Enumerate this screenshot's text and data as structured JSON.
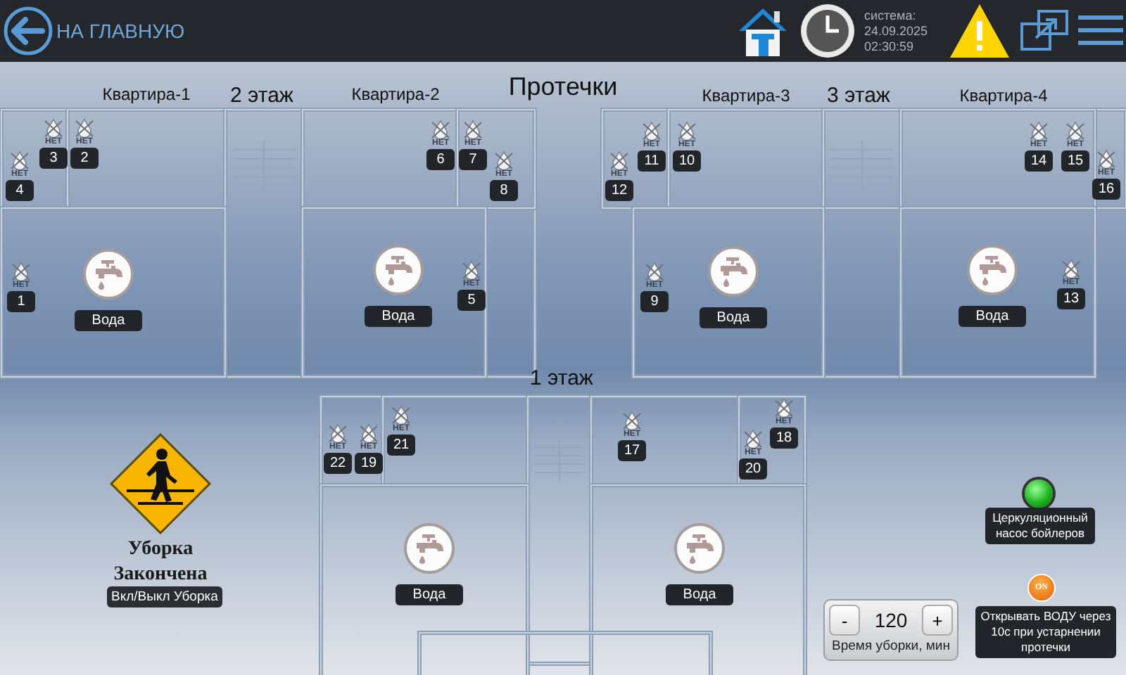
{
  "header": {
    "back_label": "НА ГЛАВНУЮ",
    "system_label": "система:",
    "date": "24.09.2025",
    "time": "02:30:59"
  },
  "title": "Протечки",
  "floors": [
    {
      "label": "2 этаж"
    },
    {
      "label": "3 этаж"
    },
    {
      "label": "1 этаж"
    }
  ],
  "apartments": [
    {
      "label": "Квартира-1"
    },
    {
      "label": "Квартира-2"
    },
    {
      "label": "Квартира-3"
    },
    {
      "label": "Квартира-4"
    }
  ],
  "sensors": [
    {
      "number": "3",
      "status": "НЕТ",
      "leak": false
    },
    {
      "number": "2",
      "status": "НЕТ",
      "leak": false
    },
    {
      "number": "6",
      "status": "НЕТ",
      "leak": false
    },
    {
      "number": "7",
      "status": "НЕТ",
      "leak": false
    },
    {
      "number": "11",
      "status": "НЕТ",
      "leak": false
    },
    {
      "number": "10",
      "status": "НЕТ",
      "leak": false
    },
    {
      "number": "14",
      "status": "НЕТ",
      "leak": false
    },
    {
      "number": "15",
      "status": "НЕТ",
      "leak": false
    },
    {
      "number": "4",
      "status": "НЕТ",
      "leak": false
    },
    {
      "number": "8",
      "status": "НЕТ",
      "leak": false
    },
    {
      "number": "12",
      "status": "НЕТ",
      "leak": false
    },
    {
      "number": "16",
      "status": "НЕТ",
      "leak": false
    },
    {
      "number": "1",
      "status": "НЕТ",
      "leak": false
    },
    {
      "number": "5",
      "status": "НЕТ",
      "leak": false
    },
    {
      "number": "9",
      "status": "НЕТ",
      "leak": false
    },
    {
      "number": "13",
      "status": "НЕТ",
      "leak": false
    },
    {
      "number": "21",
      "status": "НЕТ",
      "leak": false
    },
    {
      "number": "17",
      "status": "НЕТ",
      "leak": false
    },
    {
      "number": "18",
      "status": "НЕТ",
      "leak": false
    },
    {
      "number": "22",
      "status": "НЕТ",
      "leak": false
    },
    {
      "number": "19",
      "status": "НЕТ",
      "leak": false
    },
    {
      "number": "20",
      "status": "НЕТ",
      "leak": false
    }
  ],
  "valves": [
    {
      "label": "Вода"
    },
    {
      "label": "Вода"
    },
    {
      "label": "Вода"
    },
    {
      "label": "Вода"
    },
    {
      "label": "Вода"
    },
    {
      "label": "Вода"
    }
  ],
  "cleaning": {
    "status": "Уборка Закончена",
    "button": "Вкл/Выкл Уборка"
  },
  "pump": {
    "label": "Церкуляционный насос бойлеров",
    "on": true
  },
  "auto_open": {
    "toggle": "ON",
    "label": "Открывать ВОДУ через 10с при устарнении протечки",
    "on": true
  },
  "timer": {
    "minus": "-",
    "value": "120",
    "plus": "+",
    "label": "Время уборки, мин"
  }
}
